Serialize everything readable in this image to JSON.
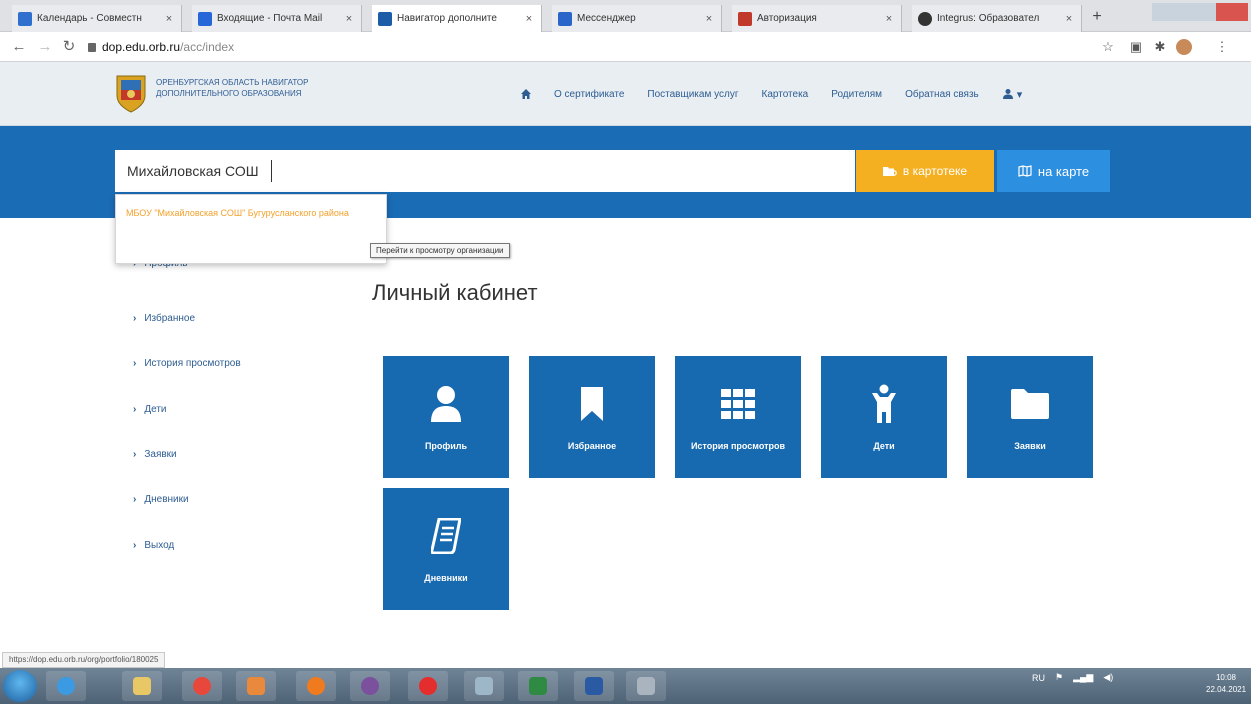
{
  "browser": {
    "tabs": [
      {
        "label": "Календарь - Совместн",
        "favicon_color": "#2f6fce"
      },
      {
        "label": "Входящие - Почта Mail",
        "favicon_color": "#2567d8"
      },
      {
        "label": "Навигатор дополните",
        "favicon_color": "#1d5da8"
      },
      {
        "label": "Мессенджер",
        "favicon_color": "#2a66c9"
      },
      {
        "label": "Авторизация",
        "favicon_color": "#c0392b"
      },
      {
        "label": "Integrus: Образовател",
        "favicon_color": "#333333"
      }
    ],
    "active_tab_index": 2,
    "close_glyph": "×",
    "new_tab_glyph": "+",
    "url_host": "dop.edu.orb.ru",
    "url_path": "/acc/index",
    "status_url": "https://dop.edu.orb.ru/org/portfolio/180025"
  },
  "site": {
    "logo_text": "ОРЕНБУРГСКАЯ ОБЛАСТЬ НАВИГАТОР ДОПОЛНИТЕЛЬНОГО ОБРАЗОВАНИЯ",
    "nav": {
      "certificate": "О сертификате",
      "providers": "Поставщикам услуг",
      "catalog": "Картотека",
      "parents": "Родителям",
      "feedback": "Обратная связь"
    },
    "user_caret": "▾"
  },
  "search": {
    "value": "Михайловская СОШ",
    "catalog_button": "в картотеке",
    "map_button": "на карте",
    "suggestion": "МБОУ \"Михайловская СОШ\" Бугурусланского района",
    "tooltip": "Перейти к просмотру организации"
  },
  "sidebar": {
    "chevron": "›",
    "items": [
      {
        "label": "Профиль"
      },
      {
        "label": "Избранное"
      },
      {
        "label": "История просмотров"
      },
      {
        "label": "Дети"
      },
      {
        "label": "Заявки"
      },
      {
        "label": "Дневники"
      },
      {
        "label": "Выход"
      }
    ]
  },
  "main": {
    "title": "Личный кабинет",
    "tiles": [
      {
        "label": "Профиль",
        "icon": "user-icon"
      },
      {
        "label": "Избранное",
        "icon": "bookmark-icon"
      },
      {
        "label": "История просмотров",
        "icon": "grid-icon"
      },
      {
        "label": "Дети",
        "icon": "child-icon"
      },
      {
        "label": "Заявки",
        "icon": "folder-icon"
      },
      {
        "label": "Дневники",
        "icon": "diary-icon"
      }
    ]
  },
  "taskbar": {
    "lang": "RU",
    "time": "10:08",
    "date": "22.04.2021"
  },
  "colors": {
    "primary_blue": "#1a6cb5",
    "tile_blue": "#1769b0",
    "accent_orange": "#f5b022",
    "map_blue": "#2c8fe0"
  }
}
